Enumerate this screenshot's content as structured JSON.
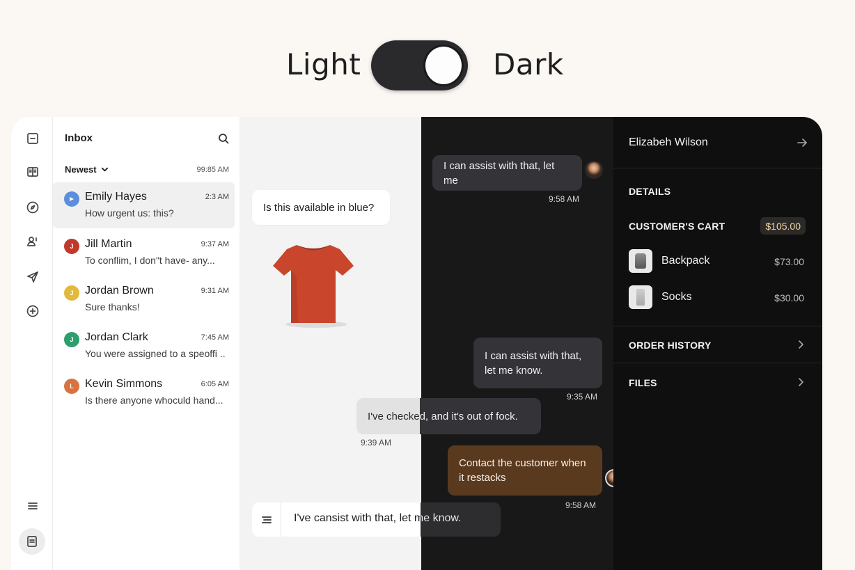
{
  "theme_toggle": {
    "light_label": "Light",
    "dark_label": "Dark",
    "state": "dark"
  },
  "rail": {
    "items": [
      {
        "icon": "minus-square-icon"
      },
      {
        "icon": "book-icon"
      },
      {
        "icon": "compass-icon"
      },
      {
        "icon": "users-icon"
      },
      {
        "icon": "send-icon"
      },
      {
        "icon": "plus-circle-icon"
      },
      {
        "icon": "menu-icon"
      },
      {
        "icon": "document-icon"
      }
    ]
  },
  "inbox": {
    "title": "Inbox",
    "sort_label": "Newest",
    "sort_time": "99:85 AM",
    "conversations": [
      {
        "name": "Emily Hayes",
        "time": "2:3 AM",
        "preview": "How urgent us: this?",
        "initial": "",
        "color": "#5b8fdc"
      },
      {
        "name": "Jill Martin",
        "time": "9:37 AM",
        "preview": "To conflim, I don\"t have- any...",
        "initial": "J",
        "color": "#c0392b"
      },
      {
        "name": "Jordan Brown",
        "time": "9:31 AM",
        "preview": "Sure  thanks!",
        "initial": "J",
        "color": "#e2b93b"
      },
      {
        "name": "Jordan Clark",
        "time": "7:45 AM",
        "preview": "You were assigned to a speoffi ..",
        "initial": "J",
        "color": "#2e9e6d"
      },
      {
        "name": "Kevin Simmons",
        "time": "6:05 AM",
        "preview": "Is there anyone whoculd hand...",
        "initial": "L",
        "color": "#d8733f"
      }
    ]
  },
  "chat": {
    "messages": [
      {
        "text": "I can assist with that, let me",
        "time": "9:58 AM"
      },
      {
        "text": "Is this available in blue?"
      },
      {
        "text": "I can assist with that, let me know.",
        "time": "9:35 AM"
      },
      {
        "text": "I've checked, and it's out of fock.",
        "time": "9:39 AM"
      },
      {
        "text": "Contact the customer when it restacks",
        "time": "9:58 AM"
      }
    ],
    "composer_text": "I've cansist with that, let me know."
  },
  "details": {
    "contact_name": "Elizabeh Wilson",
    "details_label": "DETAILS",
    "cart_label": "CUSTOMER'S CART",
    "cart_total": "$105.00",
    "cart_items": [
      {
        "name": "Backpack",
        "price": "$73.00"
      },
      {
        "name": "Socks",
        "price": "$30.00"
      }
    ],
    "order_history_label": "ORDER HISTORY",
    "files_label": "FILES"
  },
  "colors": {
    "accent_bubble": "#5a3a1f",
    "cart_total_text": "#f0d7a8",
    "dark_bg": "#0f0f0f"
  }
}
